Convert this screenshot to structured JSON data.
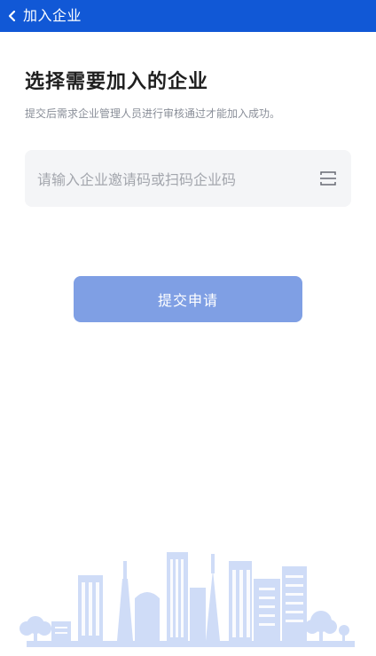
{
  "nav": {
    "title": "加入企业",
    "back_icon": "chevron-left-icon"
  },
  "header": {
    "title": "选择需要加入的企业",
    "subtitle": "提交后需求企业管理人员进行审核通过才能加入成功。"
  },
  "invite": {
    "placeholder": "请输入企业邀请码或扫码企业码",
    "value": "",
    "scan_icon": "scan-icon"
  },
  "submit": {
    "label": "提交申请"
  },
  "colors": {
    "nav_bg": "#1158d6",
    "button_bg": "#7f9fe4",
    "field_bg": "#f4f5f7",
    "illustration": "#cfdcf7"
  },
  "illustration": {
    "name": "city-skyline"
  }
}
